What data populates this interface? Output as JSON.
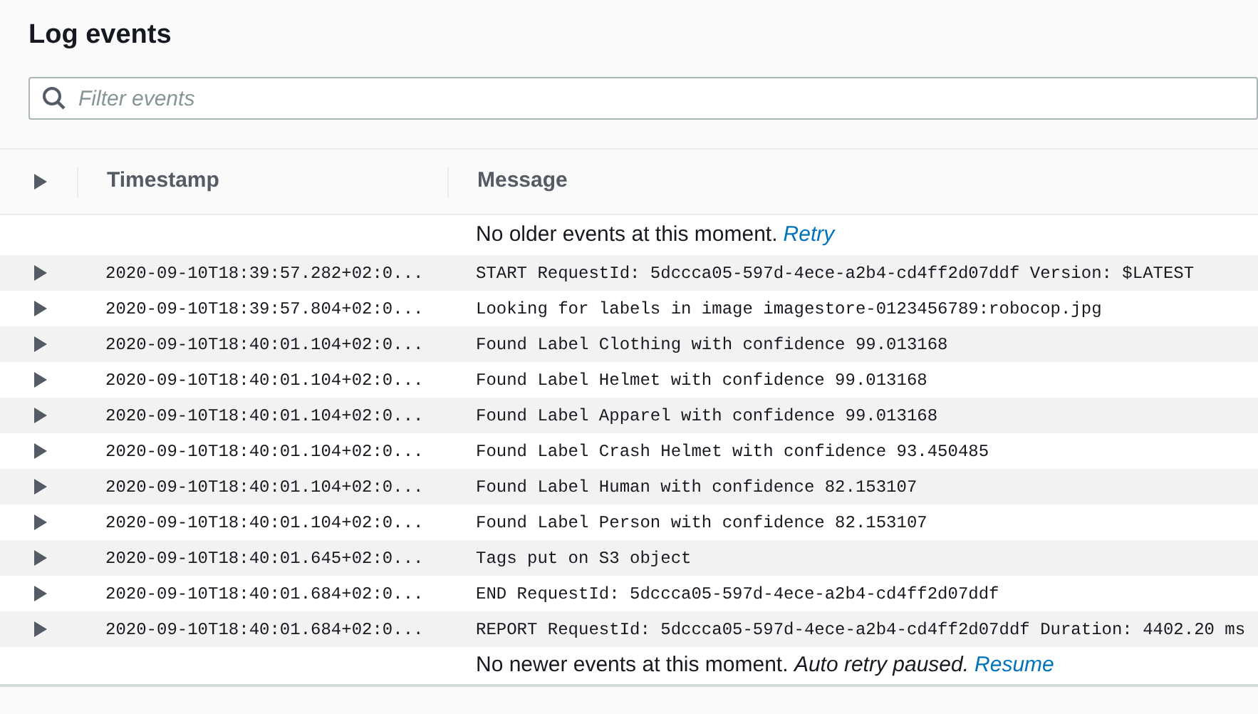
{
  "title": "Log events",
  "search": {
    "placeholder": "Filter events"
  },
  "table": {
    "columns": [
      "Timestamp",
      "Message"
    ],
    "top_notice": {
      "text": "No older events at this moment.",
      "link": "Retry"
    },
    "rows": [
      {
        "timestamp": "2020-09-10T18:39:57.282+02:0...",
        "message": "START RequestId: 5dccca05-597d-4ece-a2b4-cd4ff2d07ddf Version: $LATEST",
        "expanded": false
      },
      {
        "timestamp": "2020-09-10T18:39:57.804+02:0...",
        "message": "Looking for labels in image imagestore-0123456789:robocop.jpg",
        "expanded": false
      },
      {
        "timestamp": "2020-09-10T18:40:01.104+02:0...",
        "message": "Found Label Clothing with confidence 99.013168",
        "expanded": false
      },
      {
        "timestamp": "2020-09-10T18:40:01.104+02:0...",
        "message": "Found Label Helmet with confidence 99.013168",
        "expanded": false
      },
      {
        "timestamp": "2020-09-10T18:40:01.104+02:0...",
        "message": "Found Label Apparel with confidence 99.013168",
        "expanded": false
      },
      {
        "timestamp": "2020-09-10T18:40:01.104+02:0...",
        "message": "Found Label Crash Helmet with confidence 93.450485",
        "expanded": false
      },
      {
        "timestamp": "2020-09-10T18:40:01.104+02:0...",
        "message": "Found Label Human with confidence 82.153107",
        "expanded": false
      },
      {
        "timestamp": "2020-09-10T18:40:01.104+02:0...",
        "message": "Found Label Person with confidence 82.153107",
        "expanded": false
      },
      {
        "timestamp": "2020-09-10T18:40:01.645+02:0...",
        "message": "Tags put on S3 object",
        "expanded": false
      },
      {
        "timestamp": "2020-09-10T18:40:01.684+02:0...",
        "message": "END RequestId: 5dccca05-597d-4ece-a2b4-cd4ff2d07ddf",
        "expanded": false
      },
      {
        "timestamp": "2020-09-10T18:40:01.684+02:0...",
        "message": "REPORT RequestId: 5dccca05-597d-4ece-a2b4-cd4ff2d07ddf Duration: 4402.20 ms",
        "expanded": false
      }
    ],
    "bottom_notice": {
      "text": "No newer events at this moment. *Auto retry paused.*",
      "link": "Resume"
    }
  }
}
